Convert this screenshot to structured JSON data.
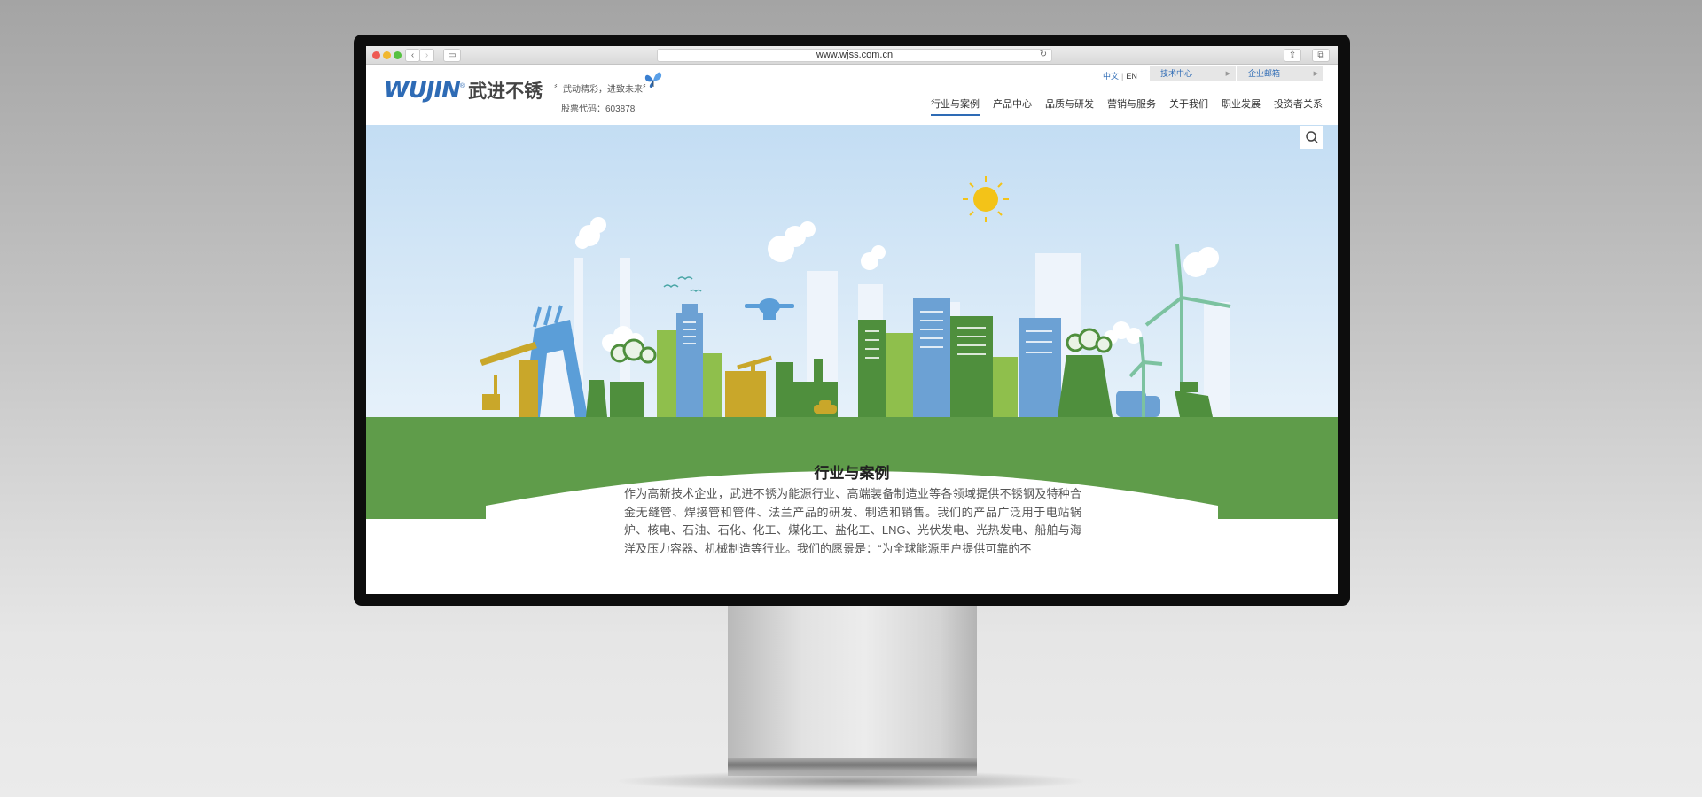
{
  "browser": {
    "url": "www.wjss.com.cn"
  },
  "header": {
    "logo_en": "WUJIN",
    "logo_reg": "®",
    "logo_cn": "武进不锈",
    "slogan": "〞武动精彩，进致未来〞",
    "stock_code": "股票代码：603878",
    "lang_cn": "中文",
    "lang_sep": "|",
    "lang_en": "EN",
    "tech_center": "技术中心",
    "enterprise_mail": "企业邮箱"
  },
  "nav": {
    "items": [
      "行业与案例",
      "产品中心",
      "品质与研发",
      "营销与服务",
      "关于我们",
      "职业发展",
      "投资者关系"
    ],
    "active_index": 0
  },
  "main": {
    "title": "行业与案例",
    "paragraph": "作为高新技术企业，武进不锈为能源行业、高端装备制造业等各领域提供不锈钢及特种合金无缝管、焊接管和管件、法兰产品的研发、制造和销售。我们的产品广泛用于电站锅炉、核电、石油、石化、化工、煤化工、盐化工、LNG、光伏发电、光热发电、船舶与海洋及压力容器、机械制造等行业。我们的愿景是：“为全球能源用户提供可靠的不"
  },
  "colors": {
    "brand_blue": "#2e6bb5",
    "grass_green": "#5f9c4a",
    "sky": "#c8e0f4",
    "sun": "#f3c318"
  },
  "icons": [
    "search-icon",
    "butterfly-icon",
    "back-icon",
    "forward-icon",
    "sidebar-icon",
    "reload-icon",
    "share-icon",
    "tabs-icon",
    "reader-icon"
  ]
}
